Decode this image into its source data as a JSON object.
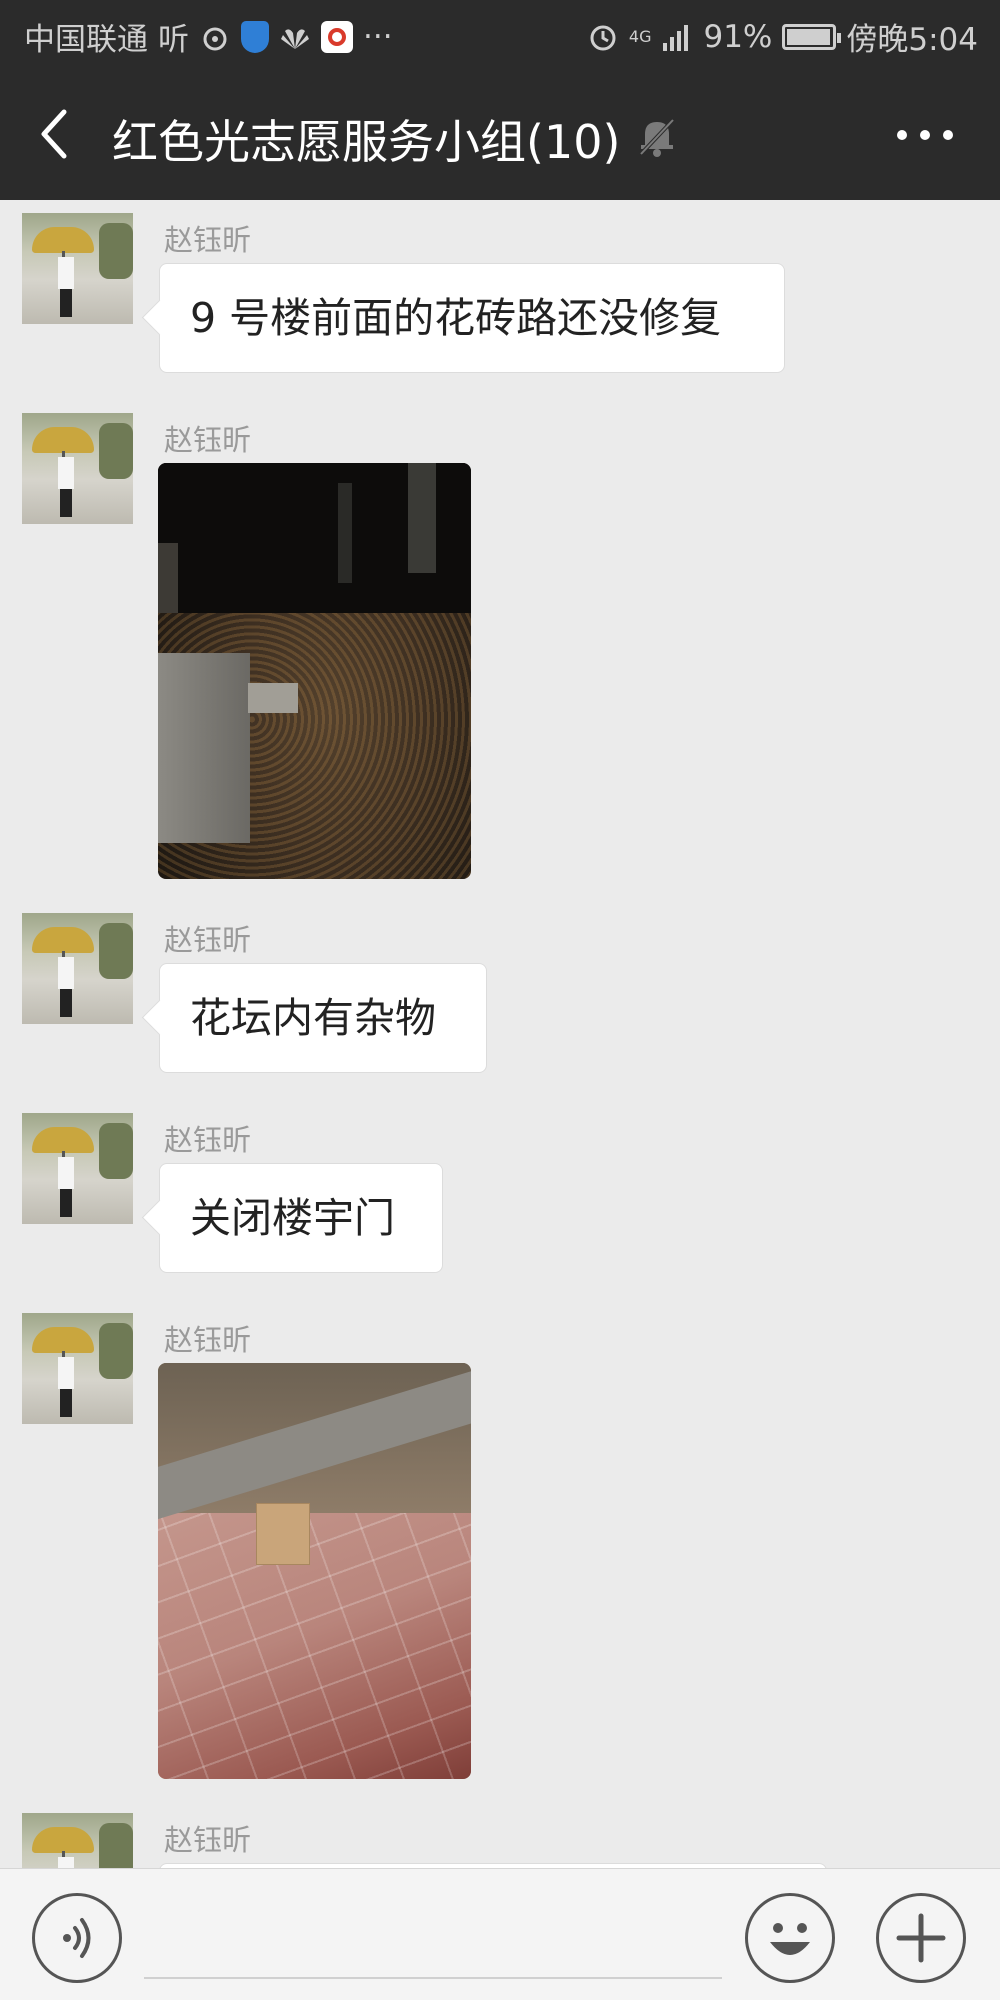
{
  "status_bar": {
    "carrier": "中国联通",
    "carrier_extra": "听",
    "overflow_dots": "···",
    "network": "4G",
    "battery_percent": "91%",
    "time": "傍晚5:04"
  },
  "header": {
    "title": "红色光志愿服务小组(10)",
    "muted": true
  },
  "messages": [
    {
      "sender": "赵钰昕",
      "type": "text",
      "text": "9 号楼前面的花砖路还没修复"
    },
    {
      "sender": "赵钰昕",
      "type": "image",
      "image_desc": "night-flowerbed-photo"
    },
    {
      "sender": "赵钰昕",
      "type": "text",
      "text": "花坛内有杂物"
    },
    {
      "sender": "赵钰昕",
      "type": "text",
      "text": "关闭楼宇门"
    },
    {
      "sender": "赵钰昕",
      "type": "image",
      "image_desc": "paving-box-photo"
    },
    {
      "sender": "赵钰昕",
      "type": "text",
      "text": ""
    }
  ],
  "input_bar": {
    "placeholder": ""
  },
  "colors": {
    "header_bg": "#2b2b2b",
    "chat_bg": "#ebebeb",
    "bubble_bg": "#ffffff"
  }
}
